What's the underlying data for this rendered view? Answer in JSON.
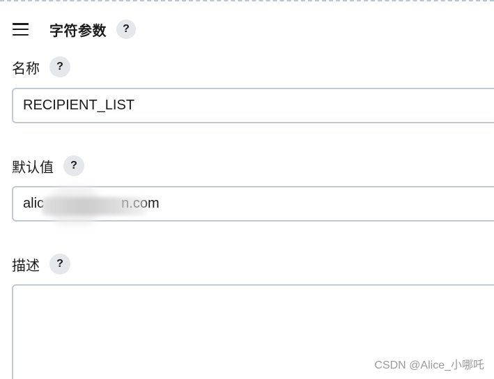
{
  "header": {
    "title": "字符参数",
    "help": "?"
  },
  "fields": {
    "name": {
      "label": "名称",
      "help": "?",
      "value": "RECIPIENT_LIST"
    },
    "default_value": {
      "label": "默认值",
      "help": "?",
      "value": "alic                    n.com"
    },
    "description": {
      "label": "描述",
      "help": "?",
      "value": ""
    }
  },
  "watermark": "CSDN @Alice_小哪吒"
}
